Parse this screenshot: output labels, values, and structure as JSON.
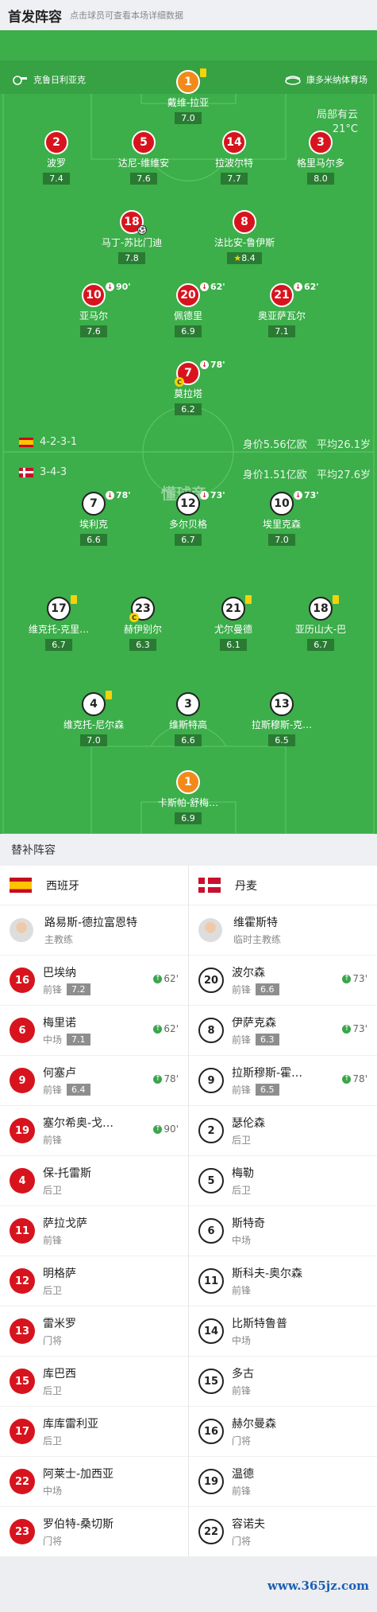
{
  "header": {
    "title": "首发阵容",
    "hint": "点击球员可查看本场详细数据"
  },
  "venue": {
    "referee": "克鲁日利亚克",
    "stadium": "康多米纳体育场"
  },
  "weather": {
    "condition": "局部有云",
    "temperature": "21°C"
  },
  "watermark": "懂球帝",
  "spain": {
    "formation": "4-2-3-1",
    "value": "身价5.56亿欧",
    "age": "平均26.1岁",
    "players": [
      {
        "num": "1",
        "name": "戴维-拉亚",
        "rating": "7.0",
        "yellow": true,
        "keeper": true
      },
      {
        "num": "2",
        "name": "波罗",
        "rating": "7.4"
      },
      {
        "num": "5",
        "name": "达尼-维维安",
        "rating": "7.6"
      },
      {
        "num": "14",
        "name": "拉波尔特",
        "rating": "7.7"
      },
      {
        "num": "3",
        "name": "格里马尔多",
        "rating": "8.0"
      },
      {
        "num": "18",
        "name": "马丁-苏比门迪",
        "rating": "7.8",
        "goal": true
      },
      {
        "num": "8",
        "name": "法比安-鲁伊斯",
        "rating": "8.4",
        "mvp": true
      },
      {
        "num": "10",
        "name": "亚马尔",
        "rating": "7.6",
        "off": "90'"
      },
      {
        "num": "20",
        "name": "佩德里",
        "rating": "6.9",
        "off": "62'"
      },
      {
        "num": "21",
        "name": "奥亚萨瓦尔",
        "rating": "7.1",
        "off": "62'"
      },
      {
        "num": "7",
        "name": "莫拉塔",
        "rating": "6.2",
        "off": "78'",
        "captain": true
      }
    ]
  },
  "denmark": {
    "formation": "3-4-3",
    "value": "身价1.51亿欧",
    "age": "平均27.6岁",
    "players": [
      {
        "num": "7",
        "name": "埃利克",
        "rating": "6.6",
        "off": "78'"
      },
      {
        "num": "12",
        "name": "多尔贝格",
        "rating": "6.7",
        "off": "73'"
      },
      {
        "num": "10",
        "name": "埃里克森",
        "rating": "7.0",
        "off": "73'"
      },
      {
        "num": "17",
        "name": "维克托-克里…",
        "rating": "6.7",
        "yellow": true
      },
      {
        "num": "23",
        "name": "赫伊别尔",
        "rating": "6.3",
        "captain": true
      },
      {
        "num": "21",
        "name": "尤尔曼德",
        "rating": "6.1",
        "yellow": true
      },
      {
        "num": "18",
        "name": "亚历山大-巴",
        "rating": "6.7",
        "yellow": true
      },
      {
        "num": "4",
        "name": "维克托-尼尔森",
        "rating": "7.0",
        "yellow": true
      },
      {
        "num": "3",
        "name": "维斯特高",
        "rating": "6.6"
      },
      {
        "num": "13",
        "name": "拉斯穆斯-克…",
        "rating": "6.5"
      },
      {
        "num": "1",
        "name": "卡斯帕-舒梅…",
        "rating": "6.9",
        "keeper": true
      }
    ]
  },
  "subs": {
    "title": "替补阵容",
    "spain_name": "西班牙",
    "denmark_name": "丹麦",
    "spain_coach": {
      "name": "路易斯-德拉富恩特",
      "role": "主教练"
    },
    "denmark_coach": {
      "name": "维霍斯特",
      "role": "临时主教练"
    },
    "spain": [
      {
        "num": "16",
        "name": "巴埃纳",
        "pos": "前锋",
        "rating": "7.2",
        "min": "62'"
      },
      {
        "num": "6",
        "name": "梅里诺",
        "pos": "中场",
        "rating": "7.1",
        "min": "62'"
      },
      {
        "num": "9",
        "name": "何塞卢",
        "pos": "前锋",
        "rating": "6.4",
        "min": "78'"
      },
      {
        "num": "19",
        "name": "塞尔希奥-戈…",
        "pos": "前锋",
        "min": "90'"
      },
      {
        "num": "4",
        "name": "保-托雷斯",
        "pos": "后卫"
      },
      {
        "num": "11",
        "name": "萨拉戈萨",
        "pos": "前锋"
      },
      {
        "num": "12",
        "name": "明格萨",
        "pos": "后卫"
      },
      {
        "num": "13",
        "name": "雷米罗",
        "pos": "门将"
      },
      {
        "num": "15",
        "name": "库巴西",
        "pos": "后卫"
      },
      {
        "num": "17",
        "name": "库库雷利亚",
        "pos": "后卫"
      },
      {
        "num": "22",
        "name": "阿莱士-加西亚",
        "pos": "中场"
      },
      {
        "num": "23",
        "name": "罗伯特-桑切斯",
        "pos": "门将"
      }
    ],
    "denmark": [
      {
        "num": "20",
        "name": "波尔森",
        "pos": "前锋",
        "rating": "6.6",
        "min": "73'"
      },
      {
        "num": "8",
        "name": "伊萨克森",
        "pos": "前锋",
        "rating": "6.3",
        "min": "73'"
      },
      {
        "num": "9",
        "name": "拉斯穆斯-霍…",
        "pos": "前锋",
        "rating": "6.5",
        "min": "78'"
      },
      {
        "num": "2",
        "name": "瑟伦森",
        "pos": "后卫"
      },
      {
        "num": "5",
        "name": "梅勒",
        "pos": "后卫"
      },
      {
        "num": "6",
        "name": "斯特奇",
        "pos": "中场"
      },
      {
        "num": "11",
        "name": "斯科夫-奥尔森",
        "pos": "前锋"
      },
      {
        "num": "14",
        "name": "比斯特鲁普",
        "pos": "中场"
      },
      {
        "num": "15",
        "name": "多古",
        "pos": "前锋"
      },
      {
        "num": "16",
        "name": "赫尔曼森",
        "pos": "门将"
      },
      {
        "num": "19",
        "name": "温德",
        "pos": "前锋"
      },
      {
        "num": "22",
        "name": "容诺夫",
        "pos": "门将"
      }
    ]
  },
  "footer": {
    "site": "www.365jz.com"
  }
}
